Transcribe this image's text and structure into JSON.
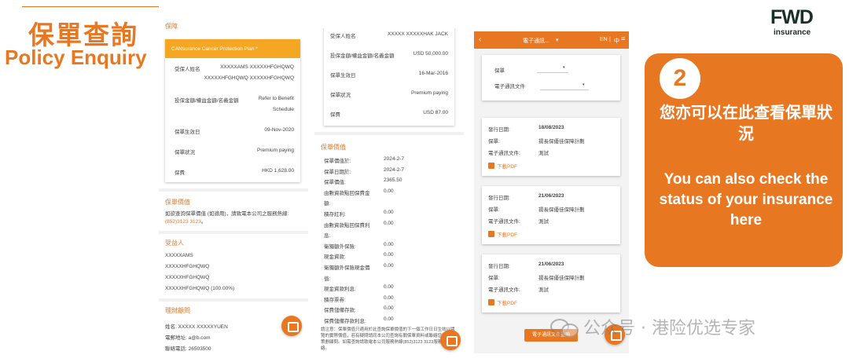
{
  "heading": {
    "zh": "保單查詢",
    "en": "Policy Enquiry"
  },
  "logo": {
    "brand": "FWD",
    "sub": "insurance"
  },
  "phone1": {
    "section_title": "保障",
    "plan_name": "CANsurance Cancer Protection Plan *",
    "rows": [
      {
        "k": "受保人姓名",
        "v1": "XXXXXAMS XXXXXHFGHQWQ",
        "v2": "XXXXXHFGHQWQ XXXXXHFGHQWQ"
      },
      {
        "k": "投保金額/權益金額/名義金額",
        "v1": "Refer to Benefit",
        "v2": "Schedule"
      },
      {
        "k": "保單生效日",
        "v1": "09-Nov-2020"
      },
      {
        "k": "保單狀況",
        "v1": "Premium paying"
      },
      {
        "k": "保費",
        "v1": "HKD 1,628.00"
      }
    ],
    "value_title": "保單價值",
    "value_text": "如欲查詢保單價值 (如適用)，請致電本公司之服務熱線:",
    "value_phone": "(852)3123 3123",
    "value_end": "。",
    "beneficiary_title": "受益人",
    "beneficiaries": [
      "XXXXXAMS",
      "XXXXXHFGHQWQ",
      "XXXXXHFGHQWQ",
      "XXXXXHFGHQWQ (100.00%)"
    ],
    "advisor_title": "理財顧問",
    "advisor_rows": [
      "姓名: XXXXX XXXXXYUEN",
      "電郵地址: a@b.com",
      "聯絡電話: 26503500"
    ]
  },
  "phone2": {
    "rows": [
      {
        "k": "受保人姓名",
        "v": "XXXXX XXXXXHAK JACK"
      },
      {
        "k": "投保金額/權益金額/名義金額",
        "v": "USD 50,000.00"
      },
      {
        "k": "保單生效日",
        "v": "16-Mar-2016"
      },
      {
        "k": "保單狀況",
        "v": "Premium paying"
      },
      {
        "k": "保費",
        "v": "USD 87.00"
      }
    ],
    "value_title": "保單價值",
    "value_rows": [
      {
        "k": "保單價值於:",
        "v": "2024-2-7"
      },
      {
        "k": "保單日期於:",
        "v": "2024-2-7"
      },
      {
        "k": "保單價值:",
        "v": "2365.50"
      },
      {
        "k": "由數資款點回保費金",
        "v": "0.00"
      },
      {
        "k": "額:",
        "v": ""
      },
      {
        "k": "積存紅利:",
        "v": "0.00"
      },
      {
        "k": "由數資款點回保費利",
        "v": "0.00"
      },
      {
        "k": "息:",
        "v": ""
      },
      {
        "k": "衛獨額外保險:",
        "v": "0.00"
      },
      {
        "k": "現金資款:",
        "v": "0.00"
      },
      {
        "k": "衛獨額外保險現金價",
        "v": "0.00"
      },
      {
        "k": "值:",
        "v": ""
      },
      {
        "k": "現金資款利息:",
        "v": "0.00"
      },
      {
        "k": "積存票券:",
        "v": "0.00"
      },
      {
        "k": "保費儲備存款:",
        "v": "0.00"
      },
      {
        "k": "保費儲備存款利息:",
        "v": "0.00"
      }
    ],
    "notice": "請注意：保單價值只適用於此查詢保單價值的下一個工作日日生效以閱覽的實際價值，若有疑問請同本公司查詢有關保單資料或聯絡您的財務策劃顧問。如需查詢請致電本公司服務熱線(852)3123 3123服務代理聯絡。"
  },
  "phone3": {
    "top_title": "電子通訊...",
    "lang": "EN",
    "lang_sep": "|",
    "lang_zh": "中",
    "filter_policy": "保單",
    "filter_doc": "電子通訊文件",
    "records": [
      {
        "date_k": "發行日期:",
        "date_v": "18/08/2023",
        "policy_k": "保單:",
        "policy_v": "揚長保優佳保障計劃",
        "doc_k": "電子通訊文件:",
        "doc_v": "測試",
        "download": "下載PDF"
      },
      {
        "date_k": "發行日期:",
        "date_v": "21/06/2023",
        "policy_k": "保單:",
        "policy_v": "揚長保優佳保障計劃",
        "doc_k": "電子通訊文件:",
        "doc_v": "測試",
        "download": "下載PDF"
      },
      {
        "date_k": "發行日期:",
        "date_v": "21/06/2023",
        "policy_k": "保單:",
        "policy_v": "揚長保優佳保障計劃",
        "doc_k": "電子通訊文件:",
        "doc_v": "測試",
        "download": "下載PDF"
      }
    ],
    "bottom_btn": "電子通訊文件查詢"
  },
  "callout": {
    "number": "2",
    "zh": "您亦可以在此查看保單狀況",
    "en": "You can also check the status of your insurance here"
  },
  "watermark": "公众号 · 港险优选专家",
  "colors": {
    "accent": "#e87722",
    "logo": "#183028",
    "callout_text": "#ffffff"
  }
}
